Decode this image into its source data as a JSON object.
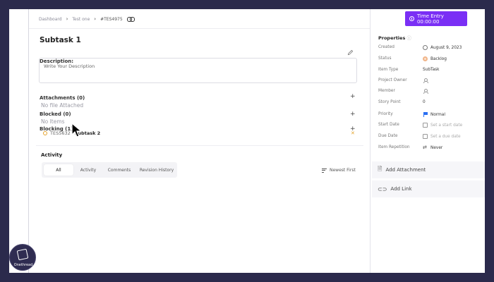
{
  "breadcrumb": {
    "items": [
      "Dashboard",
      "Test one"
    ],
    "task_id": "#TES4975"
  },
  "task": {
    "title": "Subtask 1"
  },
  "description": {
    "label": "Description:",
    "placeholder": "Write Your Description"
  },
  "attachments": {
    "label": "Attachments (0)",
    "empty_text": "No file Attached"
  },
  "blocked": {
    "label": "Blocked (0)",
    "empty_text": "No Items"
  },
  "blocking": {
    "label": "Blocking (1)",
    "items": [
      {
        "id": "TES5632",
        "name": "Subtask 2"
      }
    ]
  },
  "activity": {
    "title": "Activity",
    "tabs": [
      "All",
      "Activity",
      "Comments",
      "Revision History"
    ],
    "active_tab": "All",
    "sort_label": "Newest First"
  },
  "header": {
    "time_entry_label": "Time Entry 00:00:00"
  },
  "properties": {
    "title": "Properties",
    "info_symbol": "ⓘ",
    "rows": [
      {
        "label": "Created",
        "value": "August 9, 2023",
        "icon": "clock-icon"
      },
      {
        "label": "Status",
        "value": "Backlog",
        "icon": "backlog-icon"
      },
      {
        "label": "Item Type",
        "value": "SubTask",
        "icon": ""
      },
      {
        "label": "Project Owner",
        "value": "",
        "icon": "user-icon"
      },
      {
        "label": "Member",
        "value": "",
        "icon": "user-icon"
      },
      {
        "label": "Story Point",
        "value": "0",
        "icon": ""
      },
      {
        "label": "Priority",
        "value": "Normal",
        "icon": "flag-icon"
      },
      {
        "label": "Start Date",
        "value": "Set a start date",
        "icon": "calendar-icon"
      },
      {
        "label": "Due Date",
        "value": "Set a due date",
        "icon": "calendar-icon"
      },
      {
        "label": "Item Repetition",
        "value": "Never",
        "icon": "repeat-icon"
      }
    ]
  },
  "side_actions": {
    "add_attachment": "Add Attachment",
    "add_link": "Add Link"
  },
  "brand": {
    "name": "Onethread"
  },
  "colors": {
    "accent": "#7a2ff5",
    "status_backlog": "#f1b58a",
    "priority_flag": "#2a6ff2",
    "blocking_dot": "#e3a22b",
    "backdrop": "#2b2a4c"
  }
}
